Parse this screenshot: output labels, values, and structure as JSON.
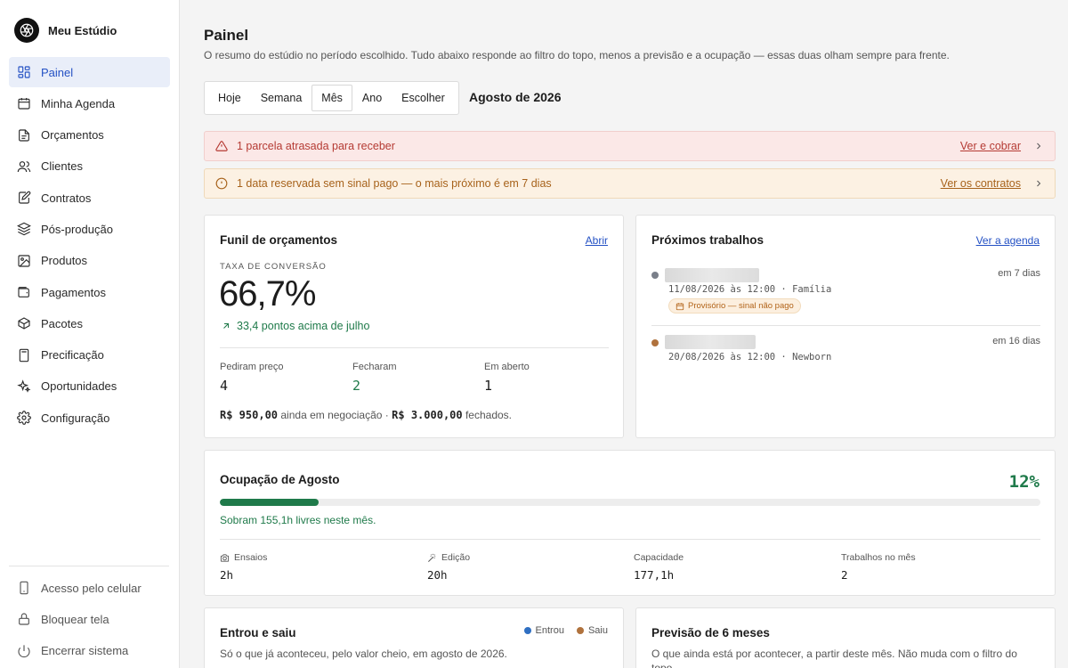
{
  "app": {
    "name": "Meu Estúdio"
  },
  "sidebar": {
    "items": [
      {
        "label": "Painel",
        "icon": "dashboard-icon",
        "active": true
      },
      {
        "label": "Minha Agenda",
        "icon": "calendar-icon"
      },
      {
        "label": "Orçamentos",
        "icon": "document-icon"
      },
      {
        "label": "Clientes",
        "icon": "users-icon"
      },
      {
        "label": "Contratos",
        "icon": "contract-icon"
      },
      {
        "label": "Pós-produção",
        "icon": "layers-icon"
      },
      {
        "label": "Produtos",
        "icon": "image-icon"
      },
      {
        "label": "Pagamentos",
        "icon": "wallet-icon"
      },
      {
        "label": "Pacotes",
        "icon": "box-icon"
      },
      {
        "label": "Precificação",
        "icon": "calculator-icon"
      },
      {
        "label": "Oportunidades",
        "icon": "sparkles-icon"
      },
      {
        "label": "Configuração",
        "icon": "gear-icon"
      }
    ],
    "bottom": [
      {
        "label": "Acesso pelo celular",
        "icon": "phone-icon"
      },
      {
        "label": "Bloquear tela",
        "icon": "lock-icon"
      },
      {
        "label": "Encerrar sistema",
        "icon": "power-icon"
      }
    ]
  },
  "header": {
    "title": "Painel",
    "subtitle": "O resumo do estúdio no período escolhido. Tudo abaixo responde ao filtro do topo, menos a previsão e a ocupação — essas duas olham sempre para frente."
  },
  "period": {
    "options": [
      "Hoje",
      "Semana",
      "Mês",
      "Ano",
      "Escolher"
    ],
    "selected": "Mês",
    "label": "Agosto de 2026"
  },
  "alerts": [
    {
      "text": "1 parcela atrasada para receber",
      "link": "Ver e cobrar",
      "tone": "red"
    },
    {
      "text": "1 data reservada sem sinal pago — o mais próximo é em 7 dias",
      "link": "Ver os contratos",
      "tone": "amber"
    }
  ],
  "funnel": {
    "title": "Funil de orçamentos",
    "link": "Abrir",
    "overline": "TAXA DE CONVERSÃO",
    "rate": "66,7%",
    "trend": "33,4 pontos acima de julho",
    "cols": [
      {
        "label": "Pediram preço",
        "value": "4"
      },
      {
        "label": "Fecharam",
        "value": "2"
      },
      {
        "label": "Em aberto",
        "value": "1"
      }
    ],
    "foot": {
      "open_amount": "R$ 950,00",
      "open_text": "ainda em negociação ·",
      "closed_amount": "R$ 3.000,00",
      "closed_text": "fechados."
    }
  },
  "upcoming": {
    "title": "Próximos trabalhos",
    "link": "Ver a agenda",
    "jobs": [
      {
        "when": "em 7 dias",
        "meta": "11/08/2026 às 12:00 · Família",
        "badge": "Provisório — sinal não pago",
        "dot": "#7a7f8a"
      },
      {
        "when": "em 16 dias",
        "meta": "20/08/2026 às 12:00 · Newborn",
        "dot": "#b0723d"
      }
    ]
  },
  "occupancy": {
    "title": "Ocupação de Agosto",
    "percent": "12%",
    "fill_fraction": 0.12,
    "note": "Sobram 155,1h livres neste mês.",
    "stats": [
      {
        "label": "Ensaios",
        "value": "2h",
        "icon": "camera-icon"
      },
      {
        "label": "Edição",
        "value": "20h",
        "icon": "magic-wand-icon"
      },
      {
        "label": "Capacidade",
        "value": "177,1h"
      },
      {
        "label": "Trabalhos no mês",
        "value": "2"
      }
    ]
  },
  "inout": {
    "title": "Entrou e saiu",
    "desc": "Só o que já aconteceu, pelo valor cheio, em agosto de 2026.",
    "legend": [
      {
        "label": "Entrou",
        "color": "#2f6fc2"
      },
      {
        "label": "Saiu",
        "color": "#b0723d"
      }
    ]
  },
  "forecast": {
    "title": "Previsão de 6 meses",
    "desc": "O que ainda está por acontecer, a partir deste mês. Não muda com o filtro do topo."
  },
  "colors": {
    "accent": "#2451c4",
    "success": "#1f7a4a",
    "danger": "#b53a33",
    "warning": "#a7621b"
  }
}
